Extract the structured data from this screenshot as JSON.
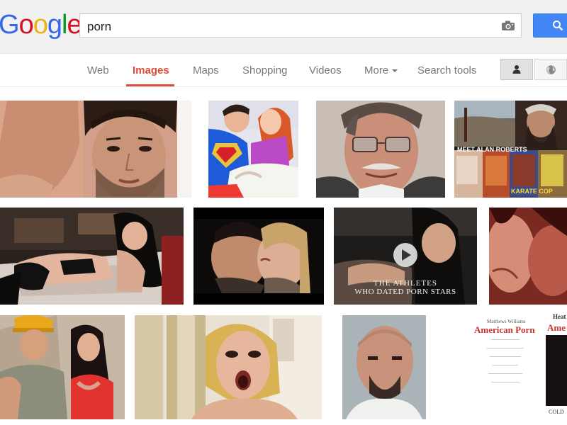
{
  "app": {
    "logo": "Google",
    "logo_letters": [
      {
        "ch": "G",
        "color": "#3369e8"
      },
      {
        "ch": "o",
        "color": "#d50f25"
      },
      {
        "ch": "o",
        "color": "#eeb211"
      },
      {
        "ch": "g",
        "color": "#3369e8"
      },
      {
        "ch": "l",
        "color": "#009925"
      },
      {
        "ch": "e",
        "color": "#d50f25"
      }
    ]
  },
  "search": {
    "query": "porn",
    "camera_icon": "camera-icon",
    "submit_icon": "search-icon",
    "button_color": "#4285f4"
  },
  "tabs": {
    "web": "Web",
    "images": "Images",
    "maps": "Maps",
    "shopping": "Shopping",
    "videos": "Videos",
    "more": "More",
    "search_tools": "Search tools",
    "active_color": "#dd4b39"
  },
  "toolbar_icons": {
    "personal": "person-icon",
    "global": "globe-icon"
  },
  "results": {
    "meet_caption": "MEET ALAN ROBERTS",
    "karate_caption": "KARATE COP",
    "athletes_caption_1": "THE ATHLETES",
    "athletes_caption_2": "WHO DATED PORN STARS",
    "book_author": "Matthews Williams",
    "book_title": "American Porn",
    "right_author": "Heat",
    "right_title": "Ame",
    "right_bottom": "COLD"
  }
}
